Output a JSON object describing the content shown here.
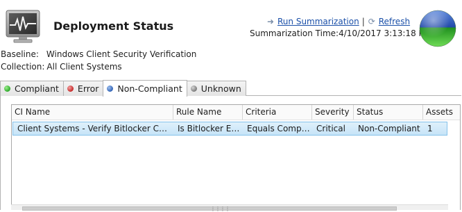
{
  "header": {
    "title": "Deployment Status",
    "run_summarization": "Run Summarization",
    "separator": "|",
    "refresh": "Refresh",
    "summarization_label": "Summarization Time:",
    "summarization_time": "4/10/2017 3:13:18 PM"
  },
  "info": {
    "baseline_label": "Baseline:",
    "baseline_value": "Windows Client Security Verification",
    "collection_label": "Collection:",
    "collection_value": "All Client Systems"
  },
  "tabs": [
    {
      "label": "Compliant",
      "dot_color": "#2da82a",
      "active": false
    },
    {
      "label": "Error",
      "dot_color": "#c62828",
      "active": false
    },
    {
      "label": "Non-Compliant",
      "dot_color": "#3163b5",
      "active": true
    },
    {
      "label": "Unknown",
      "dot_color": "#7a7a7a",
      "active": false
    }
  ],
  "table": {
    "columns": [
      "CI Name",
      "Rule Name",
      "Criteria",
      "Severity",
      "Status",
      "Assets"
    ],
    "rows": [
      {
        "ci_name": "Client Systems - Verify Bitlocker Configuration",
        "rule_name": "Is Bitlocker Enabled",
        "criteria": "Equals Compliant",
        "severity": "Critical",
        "status": "Non-Compliant",
        "assets": "1"
      }
    ]
  },
  "colors": {
    "link": "#1a4fa8",
    "selected_row": "#c6e4f8",
    "sphere_top": "#2f62c8",
    "sphere_bottom": "#39b332"
  },
  "icons": [
    "monitor-activity-icon",
    "run-arrow-icon",
    "refresh-icon",
    "status-sphere-icon"
  ]
}
